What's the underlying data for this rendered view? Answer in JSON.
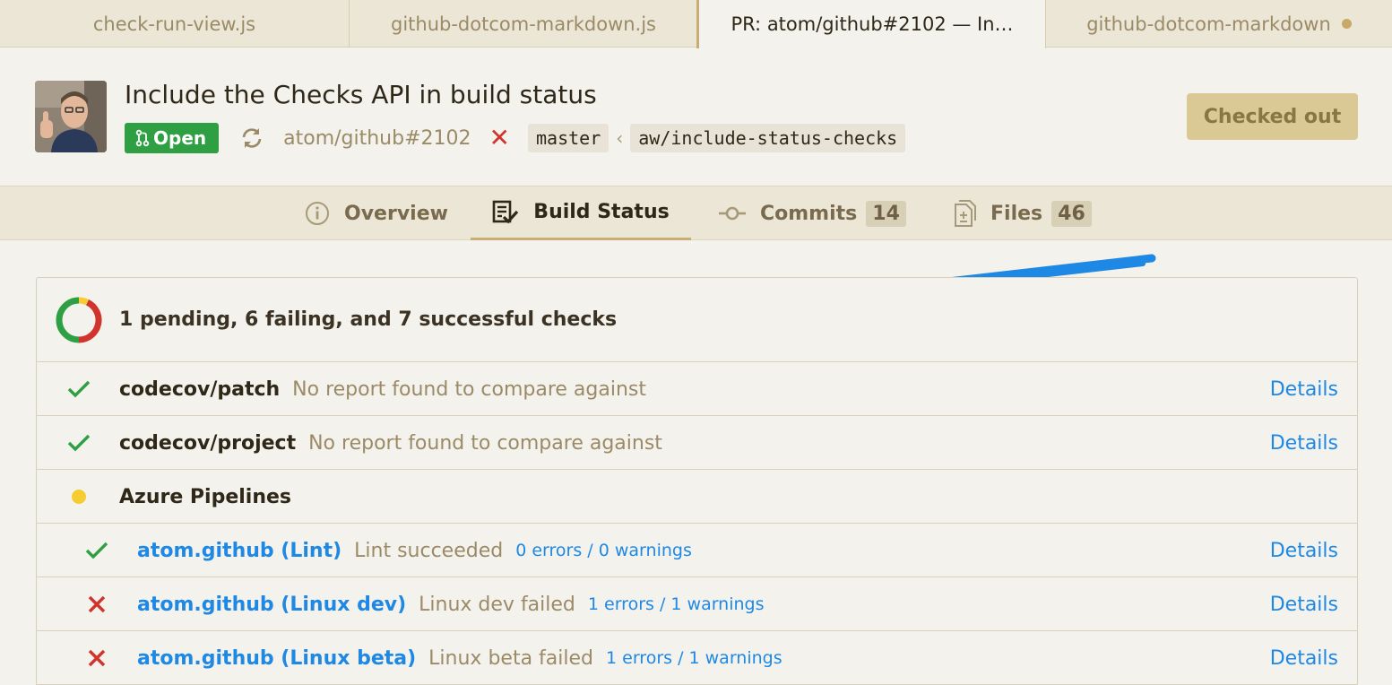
{
  "tabs": [
    {
      "label": "check-run-view.js",
      "active": false,
      "modified": false
    },
    {
      "label": "github-dotcom-markdown.js",
      "active": false,
      "modified": false
    },
    {
      "label": "PR: atom/github#2102 — In…",
      "active": true,
      "modified": false
    },
    {
      "label": "github-dotcom-markdown",
      "active": false,
      "modified": true
    }
  ],
  "pr": {
    "title": "Include the Checks API in build status",
    "state": "Open",
    "reference": "atom/github#2102",
    "base_branch": "master",
    "head_branch": "aw/include-status-checks",
    "checkout_label": "Checked out"
  },
  "nav": {
    "overview": "Overview",
    "build_status": "Build Status",
    "commits": "Commits",
    "commits_count": "14",
    "files": "Files",
    "files_count": "46"
  },
  "checks": {
    "summary": "1 pending, 6 failing, and 7 successful checks",
    "pending": 1,
    "failing": 6,
    "successful": 7,
    "rows": [
      {
        "status": "success",
        "context": "codecov/patch",
        "description": "No report found to compare against",
        "details": "Details"
      },
      {
        "status": "success",
        "context": "codecov/project",
        "description": "No report found to compare against",
        "details": "Details"
      },
      {
        "status": "pending",
        "context": "Azure Pipelines"
      },
      {
        "status": "success",
        "context": "atom.github (Lint)",
        "description": "Lint succeeded",
        "summary": "0 errors / 0 warnings",
        "details": "Details"
      },
      {
        "status": "failure",
        "context": "atom.github (Linux dev)",
        "description": "Linux dev failed",
        "summary": "1 errors / 1 warnings",
        "details": "Details"
      },
      {
        "status": "failure",
        "context": "atom.github (Linux beta)",
        "description": "Linux beta failed",
        "summary": "1 errors / 1 warnings",
        "details": "Details"
      }
    ]
  },
  "colors": {
    "success": "#2ea043",
    "failure": "#d0342c",
    "pending": "#f6cc32",
    "link": "#1e88e5",
    "annotation_arrow": "#1e88e5"
  }
}
